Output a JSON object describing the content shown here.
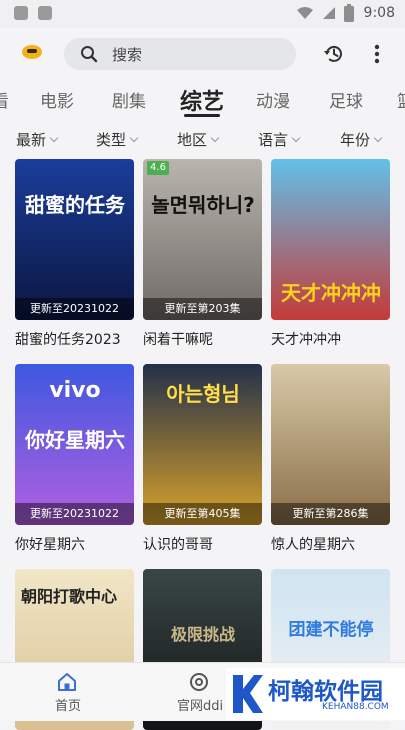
{
  "status_bar": {
    "time": "9:08"
  },
  "search": {
    "placeholder": "搜索"
  },
  "tabs": [
    {
      "label": "看"
    },
    {
      "label": "电影"
    },
    {
      "label": "剧集"
    },
    {
      "label": "综艺"
    },
    {
      "label": "动漫"
    },
    {
      "label": "足球"
    },
    {
      "label": "篮"
    }
  ],
  "filters": [
    {
      "label": "最新"
    },
    {
      "label": "类型"
    },
    {
      "label": "地区"
    },
    {
      "label": "语言"
    },
    {
      "label": "年份"
    }
  ],
  "cards": [
    {
      "title": "甜蜜的任务2023",
      "update": "更新至20231022",
      "poster_text": "甜蜜的任务",
      "color_top": "#1b3d9a",
      "color_bottom": "#0b1640"
    },
    {
      "title": "闲着干嘛呢",
      "update": "更新至第203集",
      "poster_text": "놀면뭐하니?",
      "badge": "4.6",
      "color_top": "#b9b4ad",
      "color_bottom": "#6f6a66"
    },
    {
      "title": "天才冲冲冲",
      "update": "",
      "poster_text": "天才冲冲冲",
      "color_top": "#63c0e8",
      "color_bottom": "#c43a3a"
    },
    {
      "title": "你好星期六",
      "update": "更新至20231022",
      "poster_text": "你好星期六",
      "poster_sub": "vivo",
      "color_top": "#3e58e0",
      "color_bottom": "#b25fe0"
    },
    {
      "title": "认识的哥哥",
      "update": "更新至第405集",
      "poster_text": "아는형님",
      "color_top": "#23304a",
      "color_bottom": "#d9a32a"
    },
    {
      "title": "惊人的星期六",
      "update": "更新至第286集",
      "poster_text": "",
      "color_top": "#d8c9a8",
      "color_bottom": "#8a6e48"
    },
    {
      "title": "",
      "update": "",
      "poster_text": "朝阳打歌中心",
      "color_top": "#f1e6c8",
      "color_bottom": "#d8c090"
    },
    {
      "title": "",
      "update": "",
      "poster_text": "极限挑战",
      "color_top": "#3a4646",
      "color_bottom": "#101414"
    },
    {
      "title": "",
      "update": "",
      "poster_text": "团建不能停",
      "color_top": "#cfe4f2",
      "color_bottom": "#f2f2f2"
    }
  ],
  "bottom_nav": [
    {
      "label": "首页"
    },
    {
      "label": "官网ddi"
    }
  ],
  "watermark": {
    "name": "柯翰软件园",
    "url": "KEHAN88.COM"
  },
  "colors": {
    "background": "#f4f4f6",
    "active_tab": "#222222",
    "watermark_blue": "#1e57c8"
  }
}
